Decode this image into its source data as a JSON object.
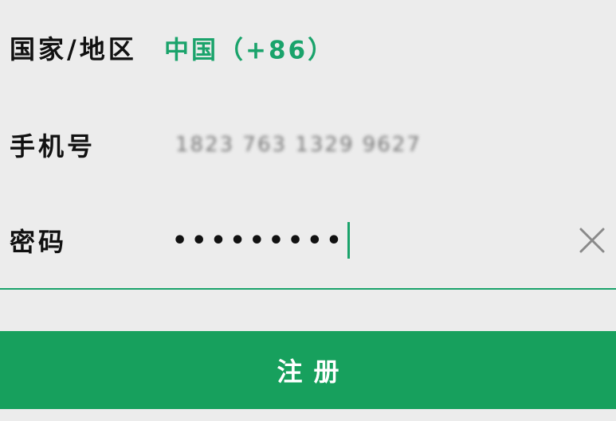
{
  "form": {
    "country_label": "国家/地区",
    "country_value": "中国（+86）",
    "phone_label": "手机号",
    "phone_value": "1823 763 1329 9627",
    "password_label": "密码",
    "password_value": "•••••••••",
    "clear_icon": "close-icon",
    "register_label": "注册"
  },
  "colors": {
    "accent": "#1aa36b",
    "button": "#17a05d",
    "background": "#ececec"
  }
}
